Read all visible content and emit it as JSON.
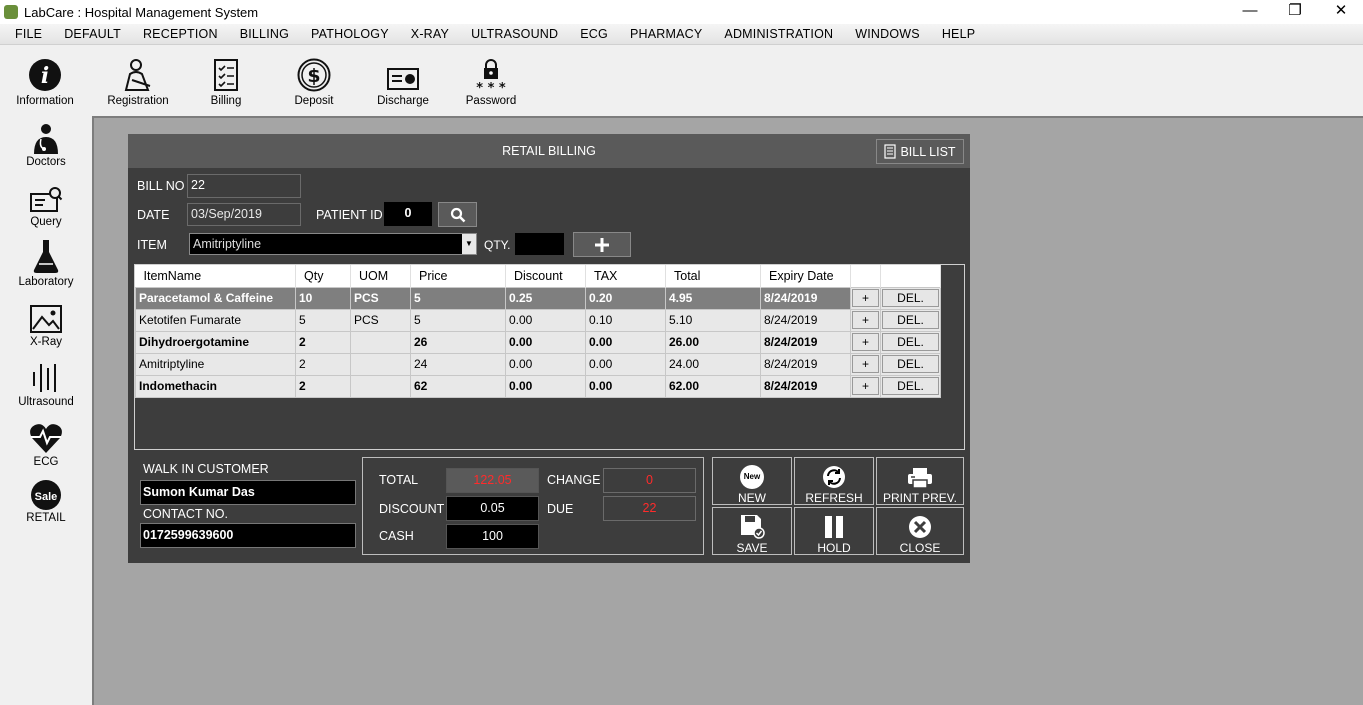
{
  "window": {
    "title": "LabCare : Hospital Management System",
    "minimize": "—",
    "maximize": "❐",
    "close": "✕"
  },
  "menu": [
    "FILE",
    "DEFAULT",
    "RECEPTION",
    "BILLING",
    "PATHOLOGY",
    "X-RAY",
    "ULTRASOUND",
    "ECG",
    "PHARMACY",
    "ADMINISTRATION",
    "WINDOWS",
    "HELP"
  ],
  "toolbar": {
    "information": "Information",
    "registration": "Registration",
    "billing": "Billing",
    "deposit": "Deposit",
    "discharge": "Discharge",
    "password": "Password"
  },
  "sidebar": {
    "doctors": "Doctors",
    "query": "Query",
    "laboratory": "Laboratory",
    "xray": "X-Ray",
    "ultrasound": "Ultrasound",
    "ecg": "ECG",
    "retail": "RETAIL",
    "sale_badge": "Sale"
  },
  "billing": {
    "title": "RETAIL BILLING",
    "bill_list": "BILL LIST",
    "bill_no_label": "BILL NO",
    "bill_no": "22",
    "date_label": "DATE",
    "date": "03/Sep/2019",
    "patient_id_label": "PATIENT ID",
    "patient_id": "0",
    "item_label": "ITEM",
    "item": "Amitriptyline",
    "qty_label": "QTY.",
    "qty": ""
  },
  "grid": {
    "headers": [
      "ItemName",
      "Qty",
      "UOM",
      "Price",
      "Discount",
      "TAX",
      "Total",
      "Expiry Date"
    ],
    "plus_label": "+",
    "del_label": "DEL.",
    "rows": [
      [
        "Paracetamol & Caffeine",
        "10",
        "PCS",
        "5",
        "0.25",
        "0.20",
        "4.95",
        "8/24/2019"
      ],
      [
        "Ketotifen Fumarate",
        "5",
        "PCS",
        "5",
        "0.00",
        "0.10",
        "5.10",
        "8/24/2019"
      ],
      [
        "Dihydroergotamine",
        "2",
        "",
        "26",
        "0.00",
        "0.00",
        "26.00",
        "8/24/2019"
      ],
      [
        "Amitriptyline",
        "2",
        "",
        "24",
        "0.00",
        "0.00",
        "24.00",
        "8/24/2019"
      ],
      [
        "Indomethacin",
        "2",
        "",
        "62",
        "0.00",
        "0.00",
        "62.00",
        "8/24/2019"
      ]
    ]
  },
  "customer": {
    "walk_in_label": "WALK IN CUSTOMER",
    "name": "Sumon Kumar Das",
    "contact_label": "CONTACT NO.",
    "contact": "0172599639600"
  },
  "totals": {
    "total_label": "TOTAL",
    "total": "122.05",
    "discount_label": "DISCOUNT",
    "discount": "0.05",
    "cash_label": "CASH",
    "cash": "100",
    "change_label": "CHANGE",
    "change": "0",
    "due_label": "DUE",
    "due": "22"
  },
  "actions": {
    "new": "NEW",
    "new_badge": "New",
    "refresh": "REFRESH",
    "print_prev": "PRINT PREV.",
    "save": "SAVE",
    "hold": "HOLD",
    "close": "CLOSE"
  },
  "colors": {
    "panel": "#3d3d3d",
    "header": "#5a5a5a",
    "workspace": "#a5a5a5",
    "alert_red": "#ff2b2b"
  }
}
